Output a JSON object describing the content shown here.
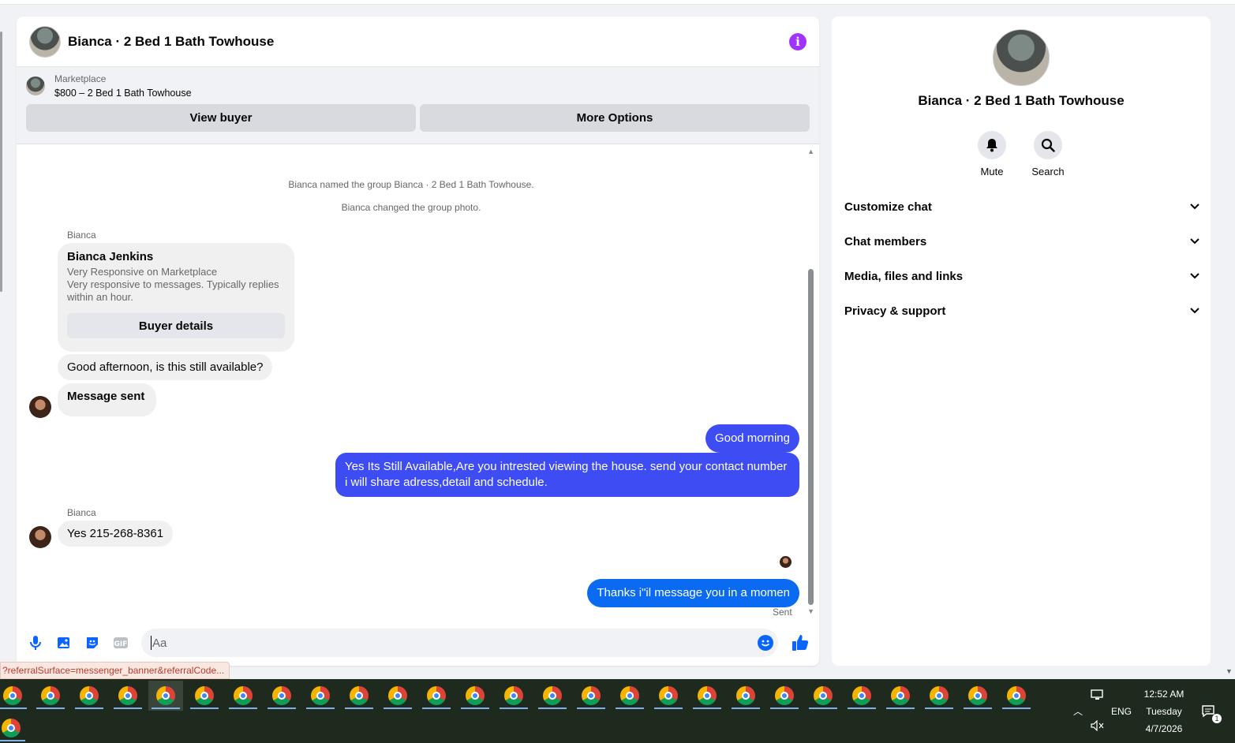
{
  "chat": {
    "title": "Bianca · 2 Bed 1 Bath Towhouse",
    "marketplace": {
      "label": "Marketplace",
      "listing": "$800 – 2 Bed 1 Bath Towhouse",
      "view_buyer": "View buyer",
      "more_options": "More Options"
    },
    "system_messages": [
      "Bianca named the group Bianca · 2 Bed 1 Bath Towhouse.",
      "Bianca changed the group photo."
    ],
    "sender_name": "Bianca",
    "buyer_card": {
      "name": "Bianca Jenkins",
      "line1": "Very Responsive on Marketplace",
      "line2": "Very responsive to messages. Typically replies within an hour.",
      "button": "Buyer details"
    },
    "messages": [
      {
        "from": "them",
        "text": "Good afternoon, is this still available?"
      },
      {
        "from": "them",
        "text": "Message sent"
      },
      {
        "from": "me",
        "text": "Good morning"
      },
      {
        "from": "me",
        "text": "Yes Its Still Available,Are you intrested viewing the house. send your contact number i will share adress,detail and schedule."
      },
      {
        "from": "them",
        "text": "Yes 215-268-8361"
      },
      {
        "from": "me",
        "text": "Thanks i\"il message you in a momen"
      }
    ],
    "status": "Sent",
    "composer": {
      "placeholder": "Aa"
    }
  },
  "status_bar_url": "?referralSurface=messenger_banner&referralCode...",
  "info_panel": {
    "name": "Bianca · 2 Bed 1 Bath Towhouse",
    "actions": [
      {
        "label": "Mute",
        "icon": "bell-icon"
      },
      {
        "label": "Search",
        "icon": "search-icon"
      }
    ],
    "sections": [
      "Customize chat",
      "Chat members",
      "Media, files and links",
      "Privacy & support"
    ]
  },
  "taskbar": {
    "time": "12:52 AM",
    "day": "Tuesday",
    "date": "4/7/2026",
    "lang": "ENG",
    "notifications": "1"
  },
  "colors": {
    "accent": "#0866ff",
    "outgoing_bubble": "#3e4cf3",
    "info_icon": "#a033ff"
  }
}
